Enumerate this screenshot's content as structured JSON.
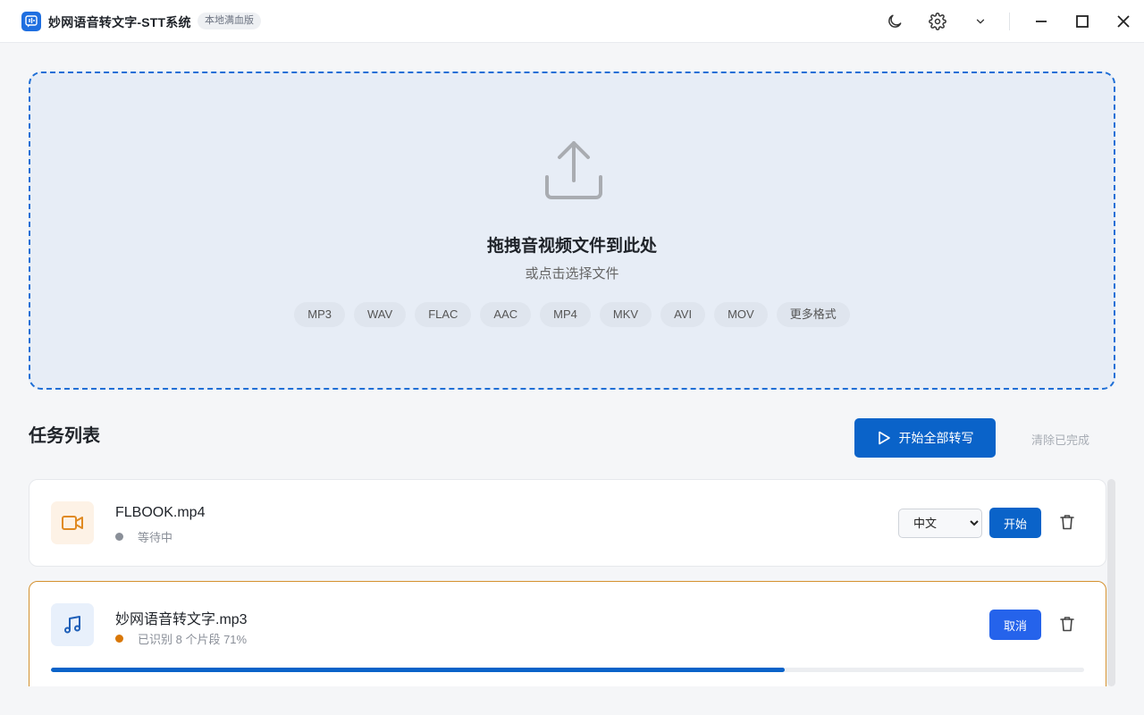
{
  "titlebar": {
    "title": "妙网语音转文字-STT系统",
    "edition": "本地满血版"
  },
  "dropzone": {
    "title": "拖拽音视频文件到此处",
    "subtitle": "或点击选择文件",
    "formats": [
      "MP3",
      "WAV",
      "FLAC",
      "AAC",
      "MP4",
      "MKV",
      "AVI",
      "MOV",
      "更多格式"
    ]
  },
  "tasks": {
    "title": "任务列表",
    "start_all_label": "开始全部转写",
    "clear_done_label": "清除已完成",
    "items": [
      {
        "file_name": "FLBOOK.mp4",
        "status": "等待中",
        "language": "中文",
        "action_label": "开始",
        "icon": "video-icon"
      },
      {
        "file_name": "妙网语音转文字.mp3",
        "status": "已识别 8 个片段 71%",
        "action_label": "取消",
        "progress": 0.71,
        "icon": "music-icon"
      }
    ]
  },
  "colors": {
    "primary": "#0a63c9",
    "dropzone_bg": "#e7edf6",
    "waiting_dot": "#8a8f98",
    "active_dot": "#d97706",
    "active_border": "#d4912f"
  }
}
